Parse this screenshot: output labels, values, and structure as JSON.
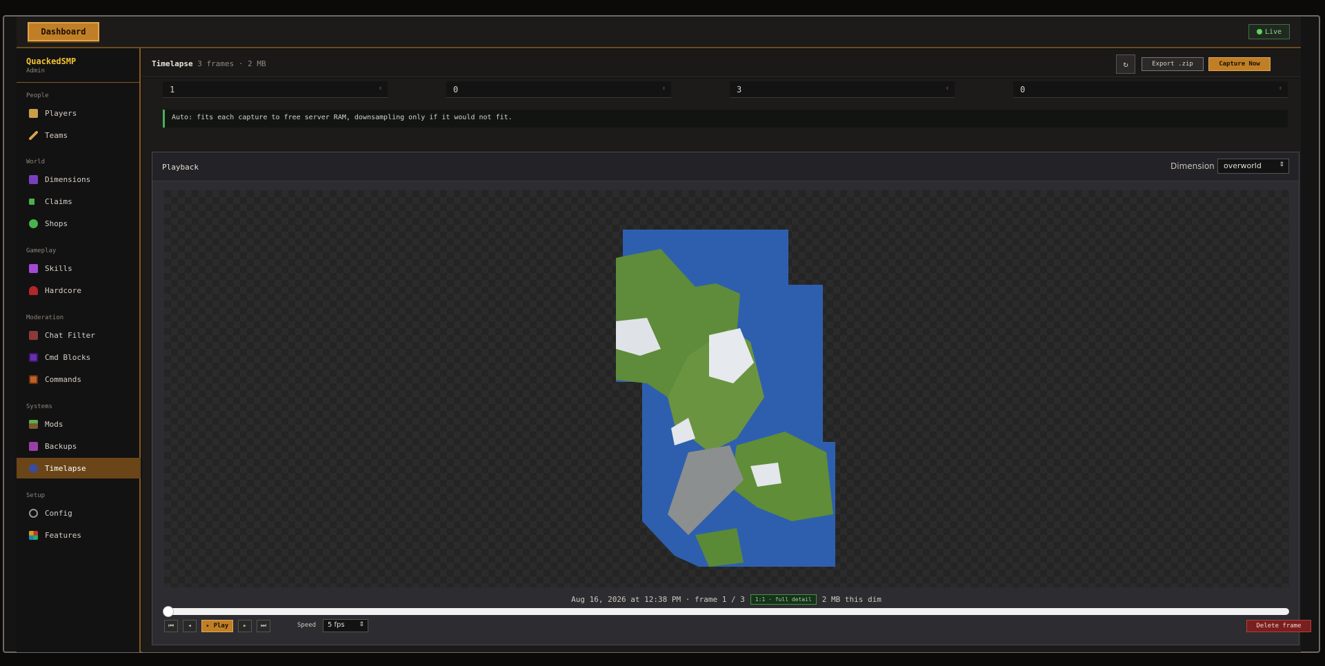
{
  "topbar": {
    "dashboard_label": "Dashboard",
    "live_label": "Live"
  },
  "brand": {
    "name": "QuackedSMP",
    "role": "Admin"
  },
  "sidebar": {
    "sections": [
      {
        "label": "People",
        "items": [
          {
            "label": "Players",
            "icon": "players-icon"
          },
          {
            "label": "Teams",
            "icon": "teams-icon"
          }
        ]
      },
      {
        "label": "World",
        "items": [
          {
            "label": "Dimensions",
            "icon": "dimensions-icon"
          },
          {
            "label": "Claims",
            "icon": "claims-flag-icon"
          },
          {
            "label": "Shops",
            "icon": "shops-icon"
          }
        ]
      },
      {
        "label": "Gameplay",
        "items": [
          {
            "label": "Skills",
            "icon": "skills-icon"
          },
          {
            "label": "Hardcore",
            "icon": "heart-icon"
          }
        ]
      },
      {
        "label": "Moderation",
        "items": [
          {
            "label": "Chat Filter",
            "icon": "chat-filter-icon"
          },
          {
            "label": "Cmd Blocks",
            "icon": "cmd-blocks-icon"
          },
          {
            "label": "Commands",
            "icon": "commands-icon"
          }
        ]
      },
      {
        "label": "Systems",
        "items": [
          {
            "label": "Mods",
            "icon": "mods-icon"
          },
          {
            "label": "Backups",
            "icon": "backups-icon"
          },
          {
            "label": "Timelapse",
            "icon": "timelapse-icon",
            "active": true
          }
        ]
      },
      {
        "label": "Setup",
        "items": [
          {
            "label": "Config",
            "icon": "config-icon"
          },
          {
            "label": "Features",
            "icon": "features-icon"
          }
        ]
      }
    ]
  },
  "header": {
    "title": "Timelapse",
    "subtitle": "3 frames · 2 MB",
    "refresh": "↻",
    "export_label": "Export .zip",
    "capture_label": "Capture Now"
  },
  "settings": {
    "values": [
      "1",
      "0",
      "3",
      "0"
    ],
    "note": "Auto: fits each capture to free server RAM, downsampling only if it would not fit."
  },
  "playback": {
    "title": "Playback",
    "dimension_label": "Dimension",
    "dimension_value": "overworld",
    "timestamp": "Aug 16, 2026 at 12:38 PM · frame 1 / 3",
    "detail_badge": "1:1 · full detail",
    "size_text": "2 MB this dim",
    "progress": 0.0,
    "controls": {
      "first": "⏮",
      "prev": "◂",
      "play": "▸ Play",
      "next": "▸",
      "last": "⏭",
      "speed_label": "Speed",
      "speed_value": "5 fps",
      "delete_label": "Delete frame"
    }
  },
  "colors": {
    "accent": "#c07f27",
    "brand": "#f1c232",
    "live": "#5fd35f",
    "danger": "#7a1f1f"
  }
}
